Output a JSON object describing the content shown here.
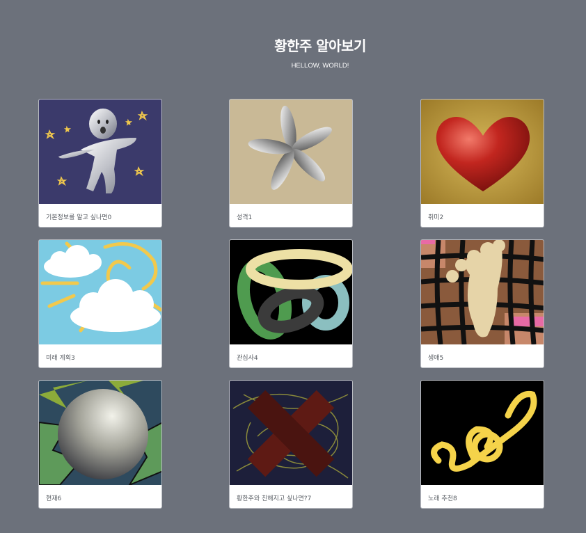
{
  "header": {
    "title": "황한주 알아보기",
    "subtitle": "HELLOW, WORLD!"
  },
  "cards": [
    {
      "label": "기본정보를 알고 싶나면0",
      "image": "silver-figure-icon",
      "bg": "#3b3a6b"
    },
    {
      "label": "성격1",
      "image": "silver-flower-icon",
      "bg": "#c9b996"
    },
    {
      "label": "취미2",
      "image": "red-heart-icon",
      "bg": "#c4a24a"
    },
    {
      "label": "미래 계획3",
      "image": "clouds-sun-icon",
      "bg": "#7ccbe3"
    },
    {
      "label": "관심사4",
      "image": "tangled-rings-icon",
      "bg": "#000000"
    },
    {
      "label": "생애5",
      "image": "foot-icon",
      "bg": "#8a5a3c"
    },
    {
      "label": "현재6",
      "image": "sphere-icon",
      "bg": "#2e4a5e"
    },
    {
      "label": "황한주와 친해지고 싶나면?7",
      "image": "x-shape-icon",
      "bg": "#1d1f3a"
    },
    {
      "label": "노래 추천8",
      "image": "treble-clef-icon",
      "bg": "#000000"
    }
  ]
}
